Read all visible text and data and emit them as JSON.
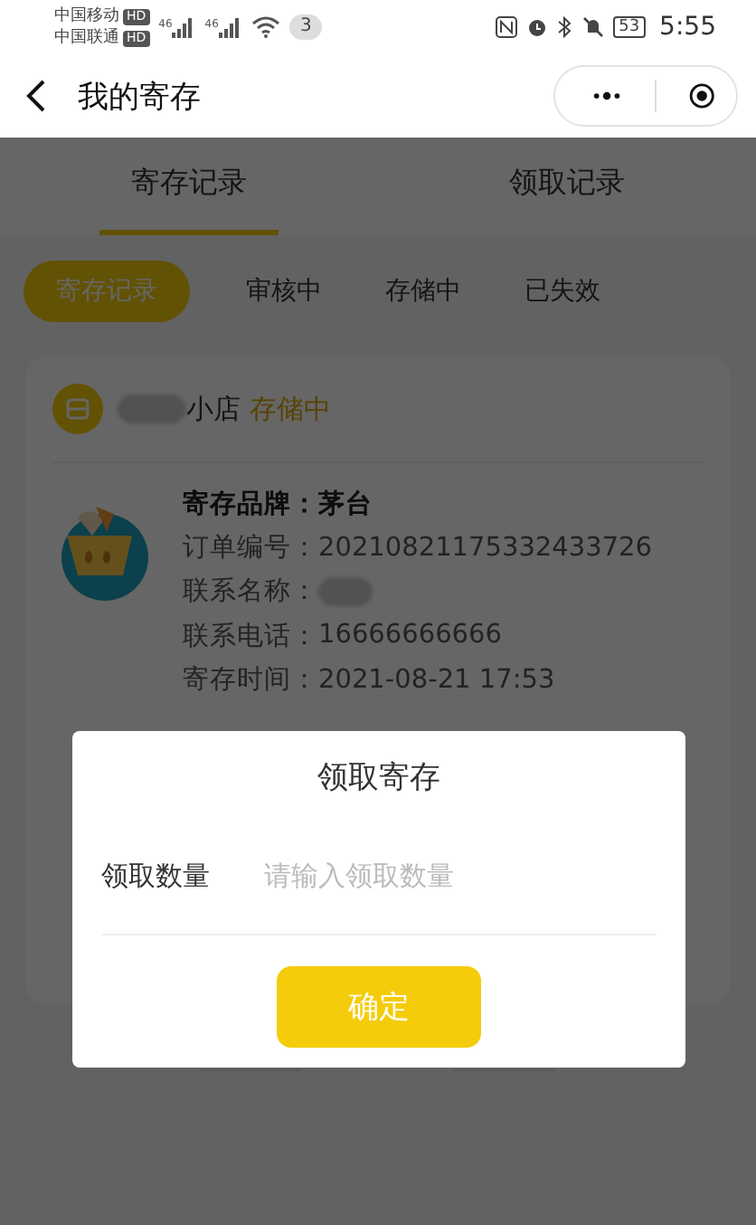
{
  "status_bar": {
    "carriers": [
      {
        "name": "中国移动",
        "badge": "HD"
      },
      {
        "name": "中国联通",
        "badge": "HD"
      }
    ],
    "signals": [
      "46",
      "46"
    ],
    "notification_count": "3",
    "battery": "53",
    "time": "5:55"
  },
  "nav": {
    "title": "我的寄存"
  },
  "tabs": [
    {
      "label": "寄存记录",
      "selected": true
    },
    {
      "label": "领取记录",
      "selected": false
    }
  ],
  "filters": [
    {
      "label": "寄存记录",
      "selected": true
    },
    {
      "label": "审核中",
      "selected": false
    },
    {
      "label": "存储中",
      "selected": false
    },
    {
      "label": "已失效",
      "selected": false
    }
  ],
  "card": {
    "shop_name": "小店",
    "status": "存储中",
    "fields": [
      {
        "label": "寄存品牌：",
        "value": "茅台",
        "kind": "bold"
      },
      {
        "label": "订单编号：",
        "value": "20210821175332433726",
        "kind": "plain"
      },
      {
        "label": "联系名称：",
        "kind": "redacted"
      },
      {
        "label": "联系电话：",
        "value": "16666666666",
        "kind": "plain"
      },
      {
        "label": "寄存时间：",
        "value": "2021-08-21 17:53",
        "kind": "plain"
      }
    ]
  },
  "dialog": {
    "title": "领取寄存",
    "field_label": "领取数量",
    "placeholder": "请输入领取数量",
    "button": "确定"
  }
}
